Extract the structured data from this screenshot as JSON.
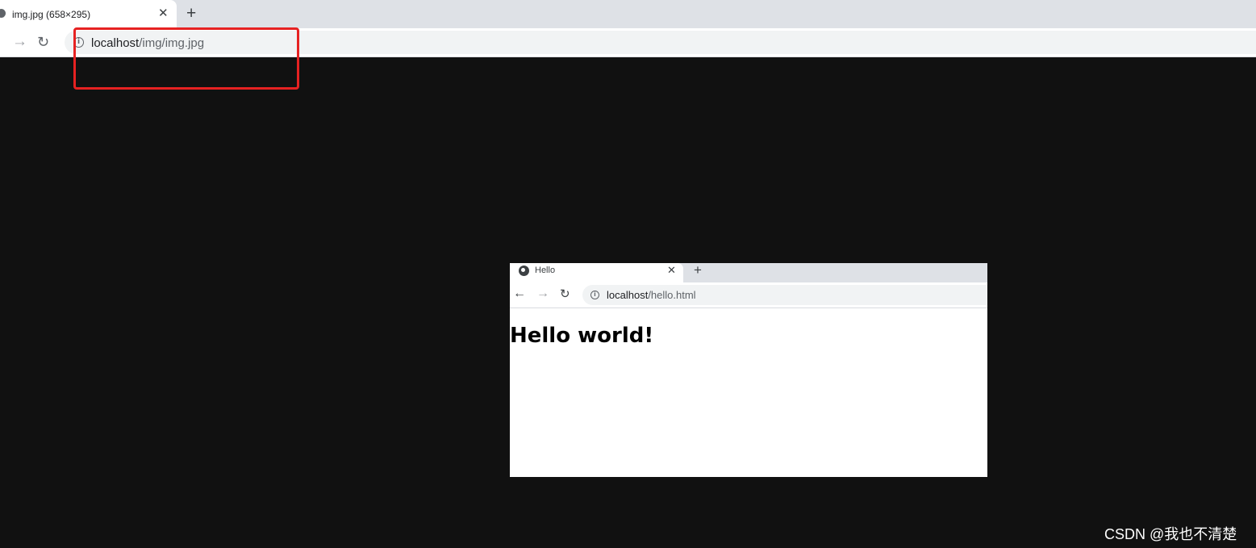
{
  "browser": {
    "tab": {
      "title": "img.jpg (658×295)",
      "close_glyph": "✕",
      "favicon": "globe-icon"
    },
    "new_tab_glyph": "+",
    "toolbar": {
      "forward_glyph": "→",
      "reload_glyph": "↻"
    },
    "address": {
      "host": "localhost",
      "path": "/img/img.jpg",
      "info_glyph": "i"
    }
  },
  "annotation": {
    "color": "#e62222"
  },
  "displayed_image": {
    "tab": {
      "title": "Hello",
      "close_glyph": "✕",
      "favicon": "globe-icon"
    },
    "new_tab_glyph": "+",
    "toolbar": {
      "back_glyph": "←",
      "forward_glyph": "→",
      "reload_glyph": "↻"
    },
    "address": {
      "host": "localhost",
      "path": "/hello.html",
      "info_glyph": "i"
    },
    "page": {
      "heading": "Hello world!"
    }
  },
  "watermark": "CSDN @我也不清楚",
  "colors": {
    "page_background": "#111111",
    "tabstrip": "#dee1e6",
    "omnibox": "#f1f3f4"
  }
}
